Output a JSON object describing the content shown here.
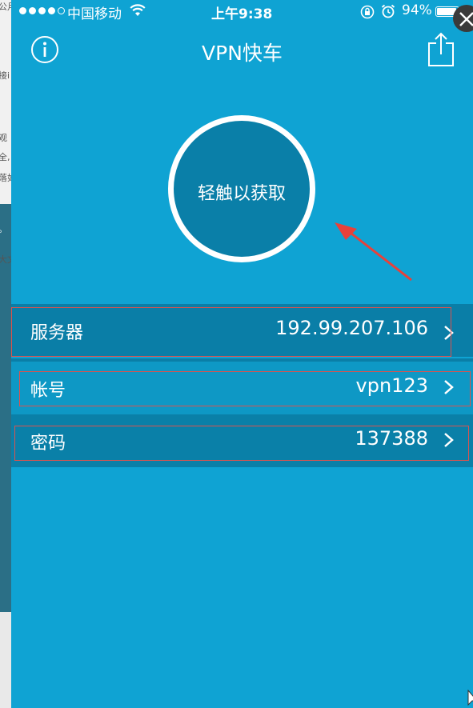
{
  "status_bar": {
    "carrier": "中国移动",
    "time": "上午9:38",
    "battery": "94%",
    "battery_level": 0.94
  },
  "nav": {
    "title": "VPN快车",
    "info_icon": "info-icon",
    "share_icon": "share-icon"
  },
  "connect": {
    "label": "轻触以获取"
  },
  "rows": [
    {
      "label": "服务器",
      "value": "192.99.207.106"
    },
    {
      "label": "帐号",
      "value": "vpn123"
    },
    {
      "label": "密码",
      "value": "137388"
    }
  ],
  "colors": {
    "background": "#0fa3d3",
    "row_dark": "#0a7ea7",
    "circle_fill": "#0a7fa8",
    "annotation": "#e8413a"
  }
}
